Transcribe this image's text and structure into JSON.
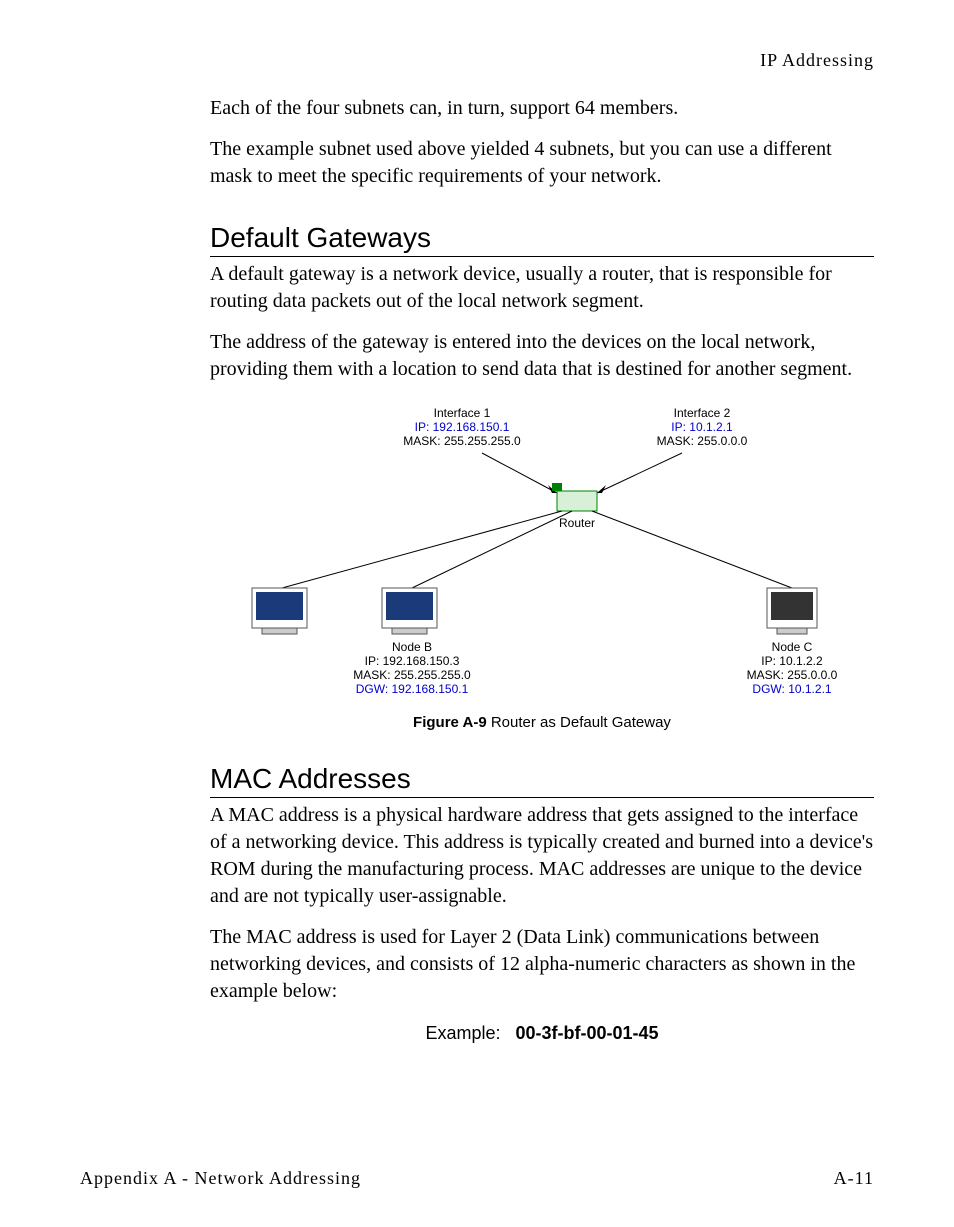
{
  "header": {
    "running": "IP Addressing"
  },
  "intro": {
    "p1": "Each of the four subnets can, in turn, support 64 members.",
    "p2": "The example subnet used above yielded 4 subnets, but you can use a different mask to meet the specific requirements of your network."
  },
  "sections": {
    "gateways": {
      "title": "Default Gateways",
      "p1": "A default gateway is a network device, usually a router, that is responsible for routing data packets out of the local network segment.",
      "p2": "The address of the gateway is entered into the devices on the local network, providing them with a location to send data that is destined for another segment."
    },
    "mac": {
      "title": "MAC Addresses",
      "p1": "A MAC address is a physical hardware address that gets assigned to the interface of a networking device. This address is typically created and burned into a device's ROM during the manufacturing process. MAC addresses are unique to the device and are not typically user-assignable.",
      "p2": "The MAC address is used for Layer 2 (Data Link) communications between networking devices, and consists of 12 alpha-numeric characters as shown in the example below:"
    }
  },
  "figure": {
    "if1": {
      "title": "Interface 1",
      "ip": "IP: 192.168.150.1",
      "mask": "MASK: 255.255.255.0"
    },
    "if2": {
      "title": "Interface 2",
      "ip": "IP: 10.1.2.1",
      "mask": "MASK: 255.0.0.0"
    },
    "router": "Router",
    "nodeB": {
      "name": "Node B",
      "ip": "IP: 192.168.150.3",
      "mask": "MASK: 255.255.255.0",
      "dgw": "DGW: 192.168.150.1"
    },
    "nodeC": {
      "name": "Node C",
      "ip": "IP: 10.1.2.2",
      "mask": "MASK: 255.0.0.0",
      "dgw": "DGW: 10.1.2.1"
    },
    "caption_label": "Figure A-9",
    "caption_text": "   Router as Default Gateway"
  },
  "example": {
    "label": "Example:",
    "mac": "00-3f-bf-00-01-45"
  },
  "footer": {
    "left": "Appendix A - Network Addressing",
    "right": "A-11"
  }
}
